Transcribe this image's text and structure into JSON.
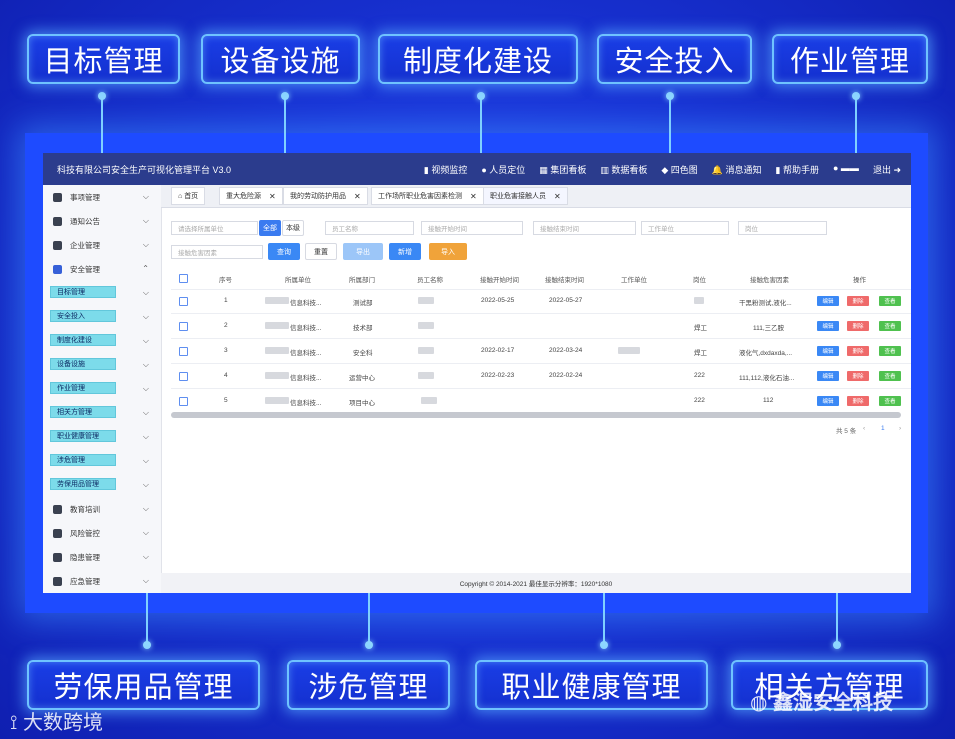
{
  "callouts_top": [
    "目标管理",
    "设备设施",
    "制度化建设",
    "安全投入",
    "作业管理"
  ],
  "callouts_bottom": [
    "劳保用品管理",
    "涉危管理",
    "职业健康管理",
    "相关方管理"
  ],
  "app": {
    "title": "科技有限公司安全生产可视化管理平台  V3.0",
    "menu": [
      "视频监控",
      "人员定位",
      "集团看板",
      "数据看板",
      "四色图",
      "消息通知",
      "帮助手册",
      "退出"
    ],
    "sidebar": {
      "items_top": [
        "事项管理",
        "通知公告",
        "企业管理",
        "安全管理"
      ],
      "subitems": [
        "目标管理",
        "安全投入",
        "制度化建设",
        "设备设施",
        "作业管理",
        "相关方管理",
        "职业健康管理",
        "涉危管理",
        "劳保用品管理"
      ],
      "items_bottom": [
        "教育培训",
        "风险管控",
        "隐患管理",
        "应急管理"
      ]
    },
    "tabs": [
      "首页",
      "重大危险源",
      "我的劳动防护用品",
      "工作场所职业危害因素检测",
      "职业危害接触人员"
    ],
    "filters": {
      "org_placeholder": "请选择所属单位",
      "all_btn": "全部",
      "self_btn": "本级",
      "name_placeholder": "员工名称",
      "start_placeholder": "接触开始时间",
      "end_placeholder": "接触结束时间",
      "unit_placeholder": "工作单位",
      "post_placeholder": "岗位",
      "factor_placeholder": "接触危害因素"
    },
    "buttons": {
      "search": "查询",
      "reset": "重置",
      "export": "导出",
      "add": "新增",
      "import": "导入"
    },
    "table": {
      "headers": [
        "序号",
        "所属单位",
        "所属部门",
        "员工名称",
        "接触开始时间",
        "接触结束时间",
        "工作单位",
        "岗位",
        "接触危害因素",
        "操作"
      ],
      "rows": [
        {
          "no": "1",
          "unit": "信息科技...",
          "dept": "测试部",
          "start": "2022-05-25",
          "end": "2022-05-27",
          "post": "",
          "factor": "干黑粉测试,液化..."
        },
        {
          "no": "2",
          "unit": "信息科技...",
          "dept": "技术部",
          "start": "",
          "end": "",
          "post": "焊工",
          "factor": "111,三乙胺"
        },
        {
          "no": "3",
          "unit": "信息科技...",
          "dept": "安全科",
          "start": "2022-02-17",
          "end": "2022-03-24",
          "post": "焊工",
          "factor": "液化气,dxdaxda,..."
        },
        {
          "no": "4",
          "unit": "信息科技...",
          "dept": "运营中心",
          "start": "2022-02-23",
          "end": "2022-02-24",
          "post": "222",
          "factor": "111,112,液化石油..."
        },
        {
          "no": "5",
          "unit": "信息科技...",
          "dept": "项目中心",
          "start": "",
          "end": "",
          "post": "222",
          "factor": "112"
        }
      ],
      "actions": [
        "编辑",
        "删除",
        "查看"
      ],
      "pager_total": "共 5 条",
      "pager_page": "1"
    },
    "footer": "Copyright © 2014-2021 最佳显示分辨率：1920*1080"
  },
  "watermark_left": "大数跨境",
  "watermark_right": "鑫湿安全科技"
}
